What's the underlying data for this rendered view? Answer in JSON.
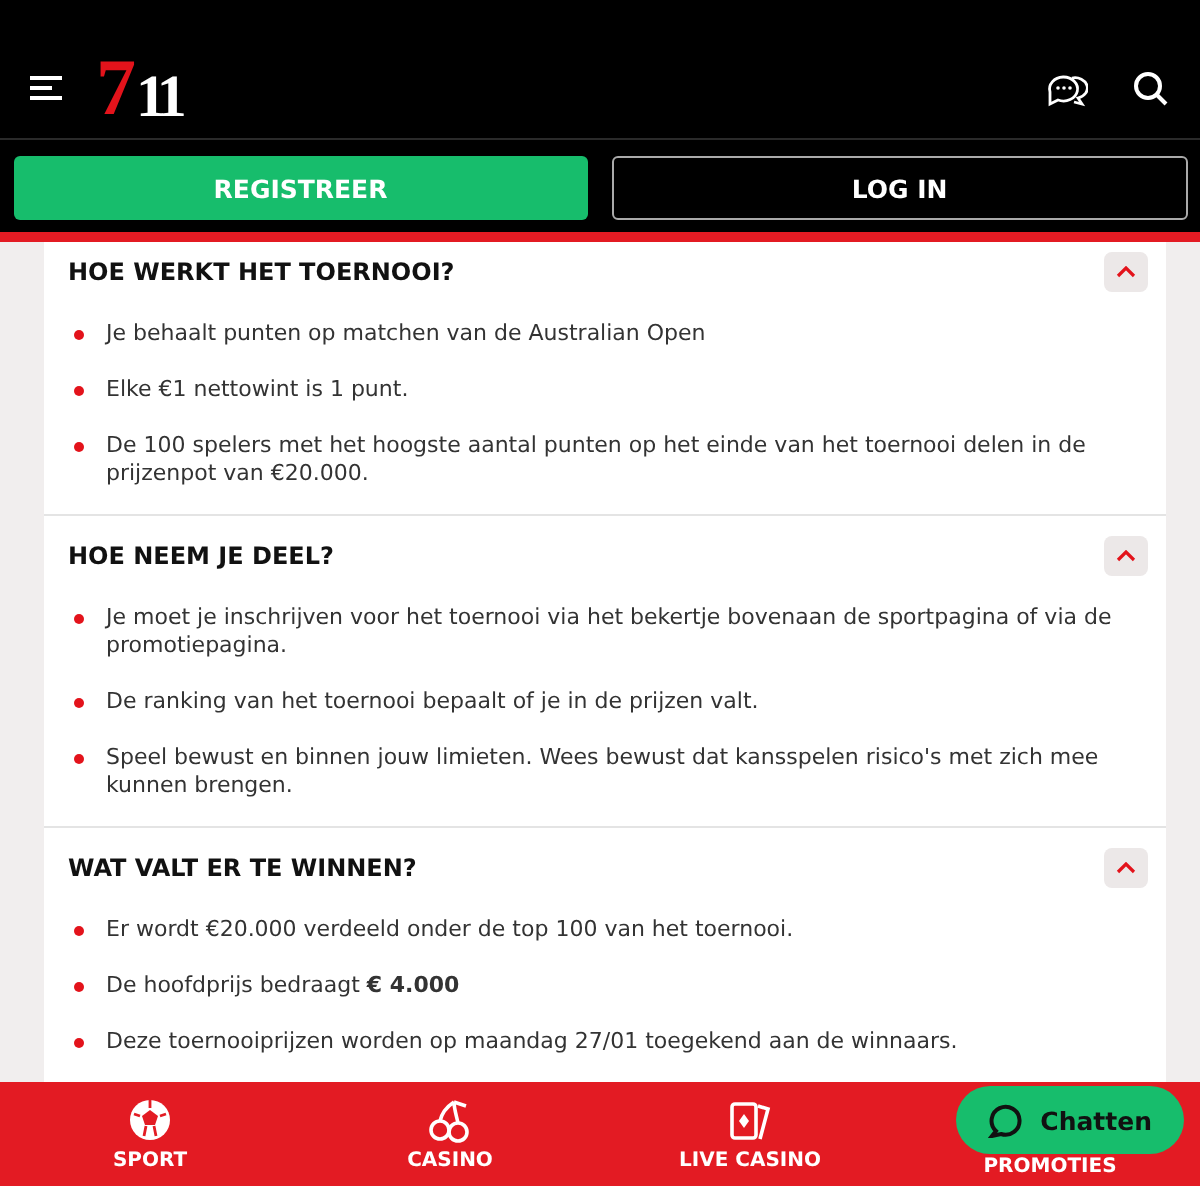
{
  "header": {
    "logo": {
      "digit_1": "7",
      "digit_2": "11"
    }
  },
  "auth_buttons": [
    {
      "label": "REGISTREER",
      "kind": "primary"
    },
    {
      "label": "LOG IN",
      "kind": "outline"
    }
  ],
  "sections": [
    {
      "title": "HOE WERKT HET TOERNOOI?",
      "expanded": true,
      "items": [
        "Je behaalt punten op matchen van de Australian Open",
        "Elke €1 nettowint is 1 punt.",
        "De 100 spelers met het hoogste aantal punten op het einde van het toernooi delen in de prijzenpot van €20.000."
      ]
    },
    {
      "title": "HOE NEEM JE DEEL?",
      "expanded": true,
      "items": [
        "Je moet je inschrijven voor het toernooi via het bekertje bovenaan de sportpagina of via de promotiepagina.",
        "De ranking van het toernooi bepaalt of je in de prijzen valt.",
        "Speel bewust en binnen jouw limieten. Wees bewust dat kansspelen risico's met zich mee kunnen brengen."
      ]
    },
    {
      "title": "WAT VALT ER TE WINNEN?",
      "expanded": true,
      "items": [
        "Er wordt €20.000 verdeeld onder de top 100 van het toernooi.",
        "De hoofdprijs bedraagt **€ 4.000**",
        "Deze toernooiprijzen worden op maandag 27/01 toegekend aan de winnaars."
      ]
    }
  ],
  "bottom_nav": [
    {
      "label": "SPORT",
      "kind": "sport"
    },
    {
      "label": "CASINO",
      "kind": "casino"
    },
    {
      "label": "LIVE CASINO",
      "kind": "live"
    },
    {
      "label": "PROMOTIES",
      "kind": "promo"
    }
  ],
  "chat_button": {
    "label": "Chatten"
  }
}
